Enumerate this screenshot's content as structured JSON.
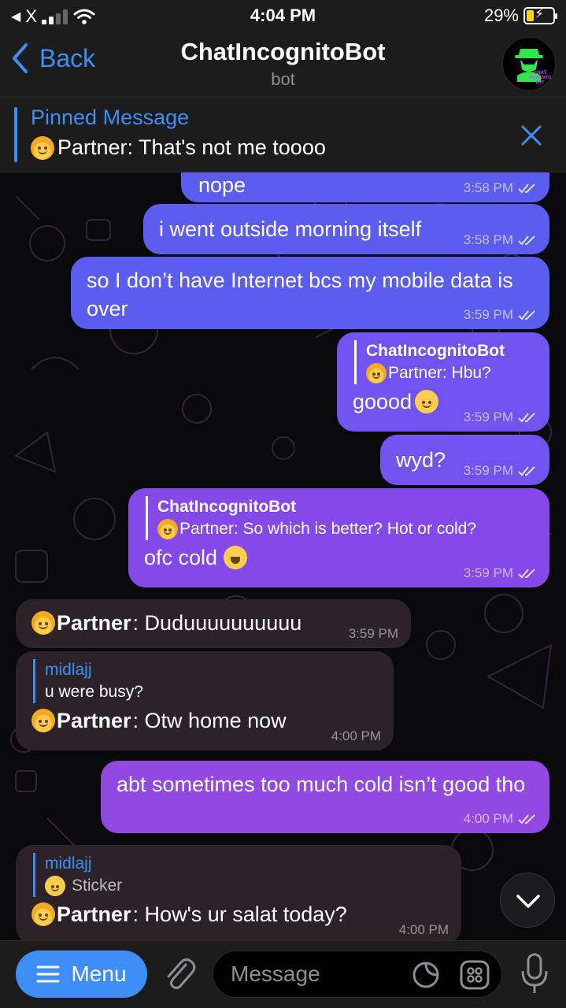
{
  "status_bar": {
    "carrier": "X",
    "time": "4:04 PM",
    "battery": "29%",
    "battery_level": 0.29
  },
  "header": {
    "back_label": "Back",
    "title": "ChatIncognitoBot",
    "subtitle": "bot",
    "avatar_text": "CHAT INCOGNITO BOT"
  },
  "pinned": {
    "title": "Pinned Message",
    "text": "Partner: That's not me toooo"
  },
  "messages": {
    "m1": {
      "text": "nope",
      "time": "3:58 PM"
    },
    "m2": {
      "text": "i went outside morning itself",
      "time": "3:58 PM"
    },
    "m3": {
      "text": "so I don’t have Internet bcs my mobile data is over",
      "time": "3:59 PM"
    },
    "m4": {
      "reply_name": "ChatIncognitoBot",
      "reply_text": "Partner: Hbu?",
      "text": "goood",
      "time": "3:59 PM"
    },
    "m5": {
      "text": "wyd?",
      "time": "3:59 PM"
    },
    "m6": {
      "reply_name": "ChatIncognitoBot",
      "reply_text": "Partner: So which is better? Hot or cold?",
      "text": "ofc cold",
      "time": "3:59 PM"
    },
    "m7": {
      "sender": "Partner",
      "text": ": Duduuuuuuuuuu",
      "time": "3:59 PM"
    },
    "m8": {
      "reply_name": "midlajj",
      "reply_text": "u were busy?",
      "sender": "Partner",
      "text": ": Otw home now",
      "time": "4:00 PM"
    },
    "m9": {
      "text": "abt sometimes too much cold isn’t good tho",
      "time": "4:00 PM"
    },
    "m10": {
      "reply_name": "midlajj",
      "reply_text": "Sticker",
      "sender": "Partner",
      "text": ": How's ur salat today?",
      "time": "4:00 PM"
    }
  },
  "bottom_bar": {
    "menu_label": "Menu",
    "input_placeholder": "Message"
  },
  "colors": {
    "accent": "#3e8ef7",
    "outgoing_bubble_top": "#5b5cf0",
    "outgoing_bubble_bottom": "#9149e2",
    "incoming_bubble": "#2b2328"
  }
}
